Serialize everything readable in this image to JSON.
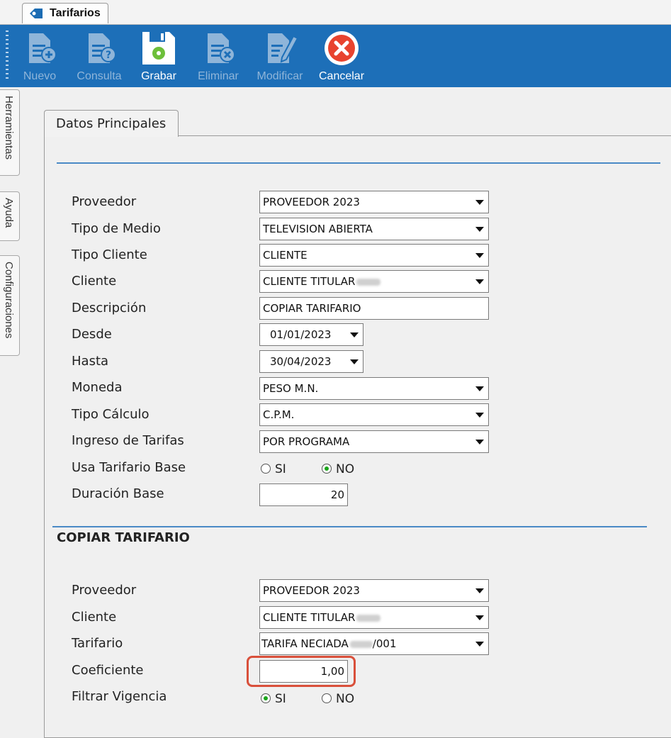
{
  "window": {
    "tab_title": "Tarifarios"
  },
  "toolbar": {
    "buttons": [
      {
        "label": "Nuevo",
        "icon": "new-document-icon",
        "enabled": false
      },
      {
        "label": "Consulta",
        "icon": "query-document-icon",
        "enabled": false
      },
      {
        "label": "Grabar",
        "icon": "save-icon",
        "enabled": true
      },
      {
        "label": "Eliminar",
        "icon": "delete-document-icon",
        "enabled": false
      },
      {
        "label": "Modificar",
        "icon": "edit-document-icon",
        "enabled": false
      },
      {
        "label": "Cancelar",
        "icon": "cancel-icon",
        "enabled": true
      }
    ]
  },
  "side_tabs": [
    "Herramientas",
    "Ayuda",
    "Configuraciones"
  ],
  "inner_tab": "Datos Principales",
  "main_form": {
    "proveedor": {
      "label": "Proveedor",
      "value": "PROVEEDOR 2023"
    },
    "tipo_medio": {
      "label": "Tipo de Medio",
      "value": "TELEVISION ABIERTA"
    },
    "tipo_cliente": {
      "label": "Tipo Cliente",
      "value": "CLIENTE"
    },
    "cliente": {
      "label": "Cliente",
      "value": "CLIENTE TITULAR"
    },
    "descripcion": {
      "label": "Descripción",
      "value": "COPIAR TARIFARIO"
    },
    "desde": {
      "label": "Desde",
      "value": "01/01/2023"
    },
    "hasta": {
      "label": "Hasta",
      "value": "30/04/2023"
    },
    "moneda": {
      "label": "Moneda",
      "value": "PESO M.N."
    },
    "tipo_calculo": {
      "label": "Tipo Cálculo",
      "value": "C.P.M."
    },
    "ingreso_tarifas": {
      "label": "Ingreso de Tarifas",
      "value": "POR PROGRAMA"
    },
    "usa_tarifario_base": {
      "label": "Usa Tarifario Base",
      "option_si": "SI",
      "option_no": "NO",
      "selected": "NO"
    },
    "duracion_base": {
      "label": "Duración Base",
      "value": "20"
    }
  },
  "copy_section": {
    "title": "COPIAR TARIFARIO",
    "proveedor": {
      "label": "Proveedor",
      "value": "PROVEEDOR 2023"
    },
    "cliente": {
      "label": "Cliente",
      "value": "CLIENTE TITULAR"
    },
    "tarifario": {
      "label": "Tarifario",
      "value_prefix": "TARIFA NECIADA",
      "value_suffix": "/001"
    },
    "coeficiente": {
      "label": "Coeficiente",
      "value": "1,00"
    },
    "filtrar_vigencia": {
      "label": "Filtrar Vigencia",
      "option_si": "SI",
      "option_no": "NO",
      "selected": "SI"
    }
  },
  "colors": {
    "toolbar_bg": "#1d6fb8",
    "accent_line": "#4a8ac6",
    "highlight": "#d9503b",
    "radio_selected": "#1aa51a"
  }
}
